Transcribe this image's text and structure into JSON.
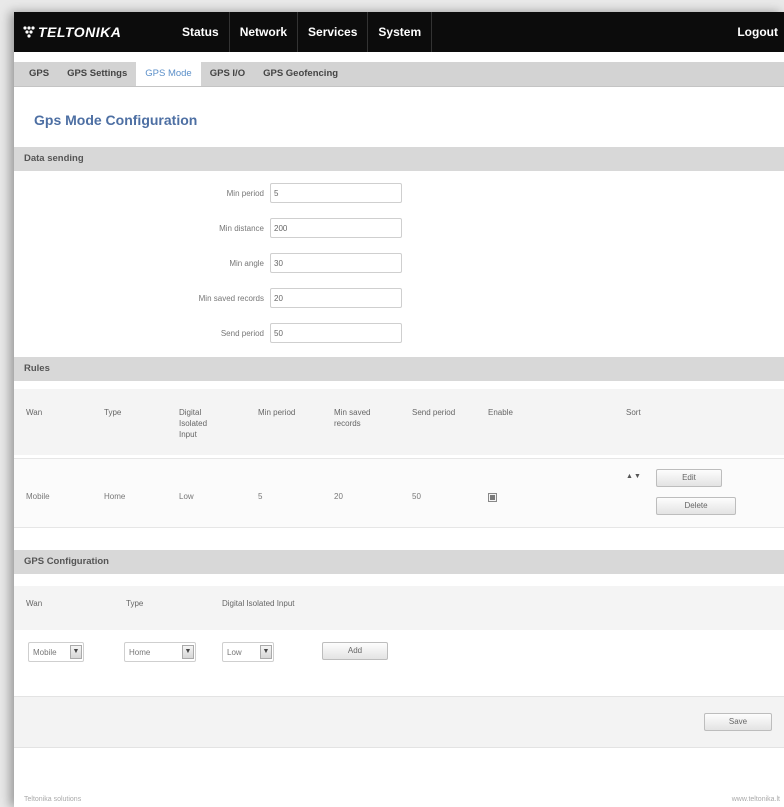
{
  "header": {
    "brand": "TELTONIKA",
    "menu": [
      "Status",
      "Network",
      "Services",
      "System"
    ],
    "logout": "Logout"
  },
  "tabs": [
    {
      "label": "GPS",
      "active": false
    },
    {
      "label": "GPS Settings",
      "active": false
    },
    {
      "label": "GPS Mode",
      "active": true
    },
    {
      "label": "GPS I/O",
      "active": false
    },
    {
      "label": "GPS Geofencing",
      "active": false
    }
  ],
  "page_title": "Gps Mode Configuration",
  "data_sending": {
    "heading": "Data sending",
    "fields": [
      {
        "label": "Min period",
        "value": "5"
      },
      {
        "label": "Min distance",
        "value": "200"
      },
      {
        "label": "Min angle",
        "value": "30"
      },
      {
        "label": "Min saved records",
        "value": "20"
      },
      {
        "label": "Send period",
        "value": "50"
      }
    ]
  },
  "rules": {
    "heading": "Rules",
    "columns": [
      "Wan",
      "Type",
      "Digital Isolated Input",
      "Min period",
      "Min saved records",
      "Send period",
      "Enable",
      "Sort"
    ],
    "rows": [
      {
        "wan": "Mobile",
        "type": "Home",
        "digital_input": "Low",
        "min_period": "5",
        "min_saved_records": "20",
        "send_period": "50",
        "enabled": true
      }
    ],
    "edit_label": "Edit",
    "delete_label": "Delete",
    "sort_up": "▲",
    "sort_down": "▼"
  },
  "gps_configuration": {
    "heading": "GPS Configuration",
    "columns": [
      "Wan",
      "Type",
      "Digital Isolated Input"
    ],
    "wan_value": "Mobile",
    "type_value": "Home",
    "input_value": "Low",
    "add_label": "Add"
  },
  "save_label": "Save",
  "footer": {
    "left": "Teltonika solutions",
    "right": "www.teltonika.lt"
  },
  "colors": {
    "topbar": "#0c0c0c",
    "title": "#4d6fa3",
    "active_tab_text": "#5b8fc9",
    "section_head": "#d8d8d8"
  }
}
